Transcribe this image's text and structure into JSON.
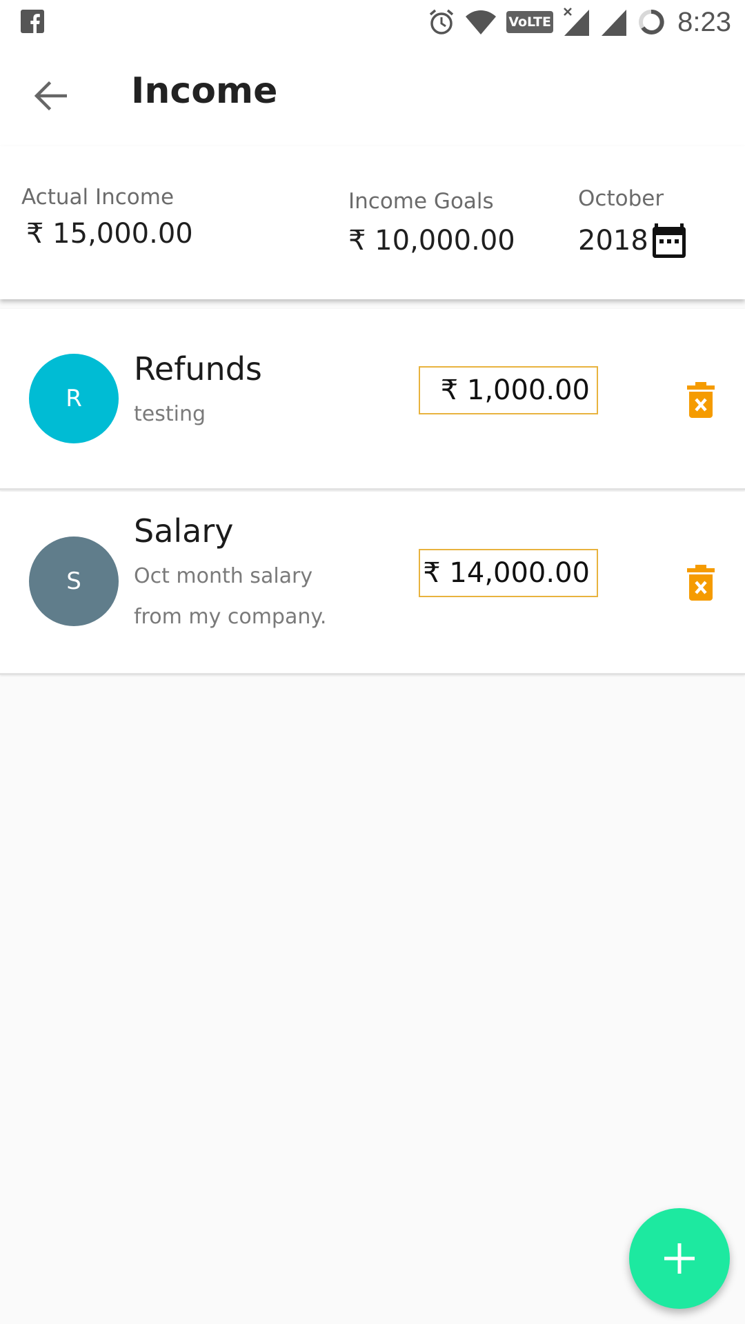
{
  "status_bar": {
    "time": "8:23",
    "volte": "VoLTE",
    "icons": [
      "facebook-icon",
      "alarm-icon",
      "wifi-icon",
      "volte-icon",
      "signal-no-data-icon",
      "signal-icon",
      "battery-charging-icon"
    ]
  },
  "app_bar": {
    "title": "Income",
    "back_icon": "arrow-back-icon"
  },
  "summary": {
    "actual_income_label": "Actual Income",
    "actual_income_value": "₹ 15,000.00",
    "income_goals_label": "Income Goals",
    "income_goals_value": "₹ 10,000.00",
    "month": "October",
    "year": "2018",
    "calendar_icon": "calendar-icon"
  },
  "entries": [
    {
      "avatar_letter": "R",
      "avatar_color": "#00bcd4",
      "title": "Refunds",
      "note": "testing",
      "amount": "₹ 1,000.00",
      "delete_icon": "delete-icon"
    },
    {
      "avatar_letter": "S",
      "avatar_color": "#607d8b",
      "title": "Salary",
      "note": "Oct month salary from my company.",
      "amount": "₹ 14,000.00",
      "delete_icon": "delete-icon"
    }
  ],
  "fab": {
    "icon": "plus-icon",
    "color": "#1de9a0"
  },
  "colors": {
    "accent_orange": "#f59b00",
    "amount_border": "#e8b33e"
  }
}
